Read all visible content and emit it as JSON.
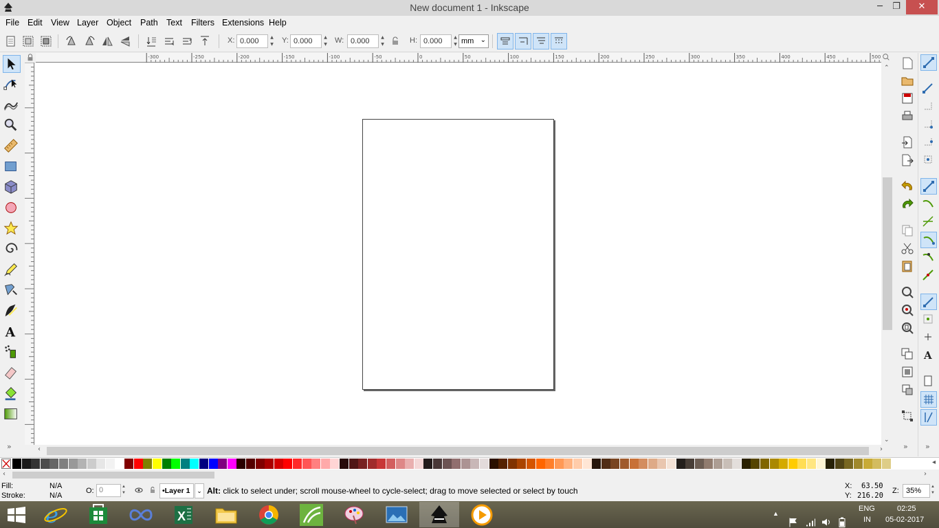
{
  "window": {
    "title": "New document 1 - Inkscape",
    "minimize": "─",
    "maximize": "❐",
    "close": "✕"
  },
  "menu": [
    "File",
    "Edit",
    "View",
    "Layer",
    "Object",
    "Path",
    "Text",
    "Filters",
    "Extensions",
    "Help"
  ],
  "tool_controls": {
    "x_label": "X:",
    "x_value": "0.000",
    "y_label": "Y:",
    "y_value": "0.000",
    "w_label": "W:",
    "w_value": "0.000",
    "h_label": "H:",
    "h_value": "0.000",
    "unit": "mm"
  },
  "ruler": {
    "ticks": [
      "-300",
      "-250",
      "-200",
      "-150",
      "-100",
      "-50",
      "0",
      "50",
      "100",
      "150",
      "200",
      "250",
      "300",
      "350",
      "400",
      "450",
      "500",
      "550",
      "600",
      "650"
    ]
  },
  "toolbox": [
    "selector-tool",
    "node-tool",
    "tweak-tool",
    "zoom-tool",
    "measure-tool",
    "rectangle-tool",
    "3dbox-tool",
    "ellipse-tool",
    "star-tool",
    "spiral-tool",
    "pencil-tool",
    "pen-tool",
    "calligraphy-tool",
    "text-tool",
    "spray-tool",
    "eraser-tool",
    "paint-bucket-tool",
    "gradient-tool"
  ],
  "palette": {
    "colors": [
      "#000000",
      "#1a1a1a",
      "#333333",
      "#4d4d4d",
      "#666666",
      "#808080",
      "#999999",
      "#b3b3b3",
      "#cccccc",
      "#e6e6e6",
      "#f2f2f2",
      "#ffffff",
      "#800000",
      "#ff0000",
      "#808000",
      "#ffff00",
      "#008000",
      "#00ff00",
      "#008080",
      "#00ffff",
      "#000080",
      "#0000ff",
      "#800080",
      "#ff00ff",
      "#2b0000",
      "#550000",
      "#800000",
      "#aa0000",
      "#d40000",
      "#ff0000",
      "#ff2a2a",
      "#ff5555",
      "#ff8080",
      "#ffaaaa",
      "#ffd5d5",
      "#280b0b",
      "#501616",
      "#782121",
      "#a02c2c",
      "#c83737",
      "#d35f5f",
      "#de8787",
      "#e9afaf",
      "#f4d7d7",
      "#241c1c",
      "#483737",
      "#6c5353",
      "#916f6f",
      "#ac9393",
      "#c8b7b7",
      "#e3dbdb",
      "#2b1100",
      "#552200",
      "#803300",
      "#aa4400",
      "#d45500",
      "#ff6600",
      "#ff7f2a",
      "#ff9955",
      "#ffb380",
      "#ffccaa",
      "#ffe6d5",
      "#28170b",
      "#502d16",
      "#784421",
      "#a05a2c",
      "#c87137",
      "#d38d5f",
      "#deaa87",
      "#e9c6af",
      "#f4e3d7",
      "#241f1c",
      "#483e37",
      "#6c5d53",
      "#917c6f",
      "#ac9d93",
      "#c8beb7",
      "#e3dedb",
      "#2b2200",
      "#554400",
      "#806600",
      "#aa8800",
      "#d4aa00",
      "#ffcc00",
      "#ffdd55",
      "#ffe680",
      "#fff6d5",
      "#282208",
      "#504416",
      "#786721",
      "#a0892c",
      "#c8ab37",
      "#d3bc5f",
      "#decd87"
    ]
  },
  "status": {
    "fill_label": "Fill:",
    "fill_value": "N/A",
    "stroke_label": "Stroke:",
    "stroke_value": "N/A",
    "opacity_label": "O:",
    "opacity_value": "0",
    "layer": "•Layer 1",
    "message_bold": "Alt:",
    "message": " click to select under; scroll mouse-wheel to cycle-select; drag to move selected or select by touch",
    "x_label": "X:",
    "x_value": "63.50",
    "y_label": "Y:",
    "y_value": "216.20",
    "zoom_label": "Z:",
    "zoom_value": "35%"
  },
  "tray": {
    "lang": "ENG",
    "region": "IN",
    "time": "02:25",
    "date": "05-02-2017"
  },
  "colors": {
    "titlebar": "#d9d9d9",
    "close": "#c75050",
    "active_toggle": "#cfe4f8",
    "taskbar": "#5a5746"
  }
}
